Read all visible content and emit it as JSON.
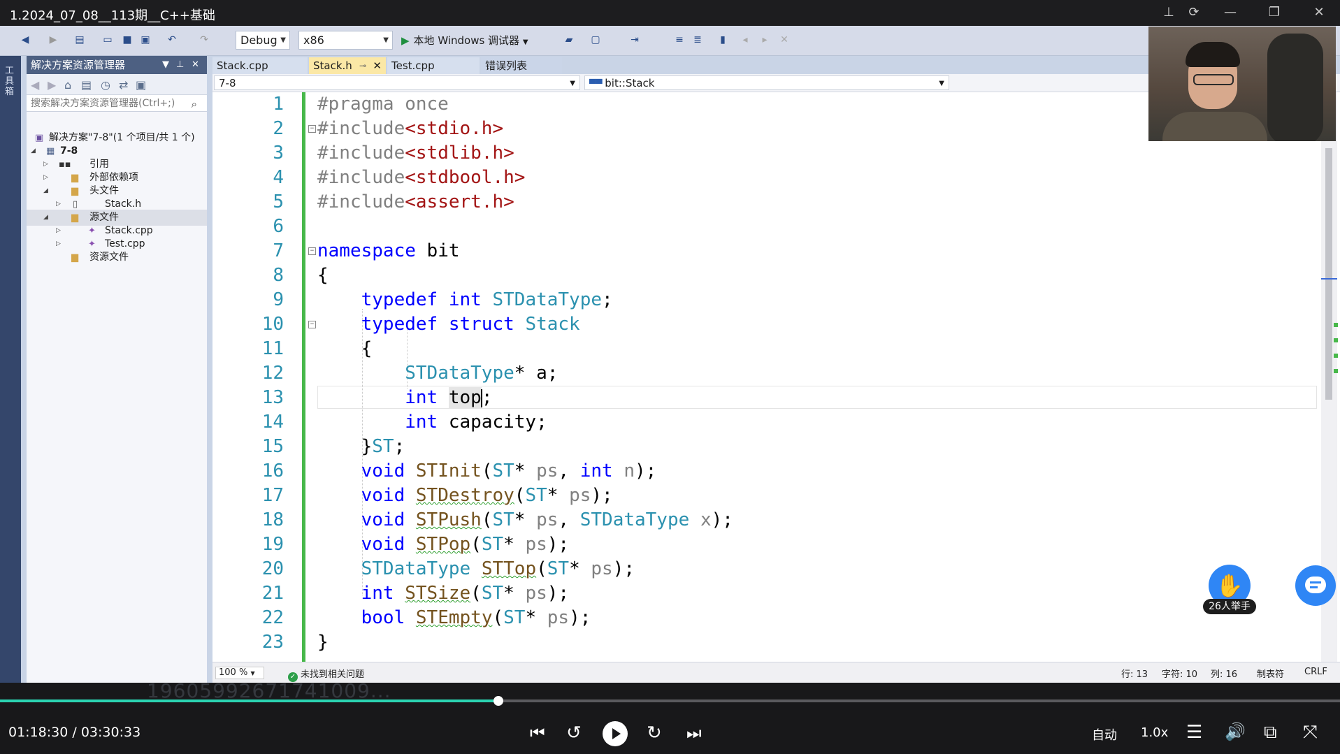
{
  "player": {
    "title": "1.2024_07_08__113期__C++基础",
    "time_current": "01:18:30",
    "time_sep": "/",
    "time_total": "03:30:33",
    "progress": 0.372,
    "quality": "自动",
    "speed": "1.0x",
    "raise_hand_label": "26人举手",
    "watermark": "19605992671741009..."
  },
  "toolbar": {
    "config": "Debug",
    "platform": "x86",
    "run_label": "本地 Windows 调试器"
  },
  "side_tab": "工具箱",
  "solution_explorer": {
    "title": "解决方案资源管理器",
    "search_placeholder": "搜索解决方案资源管理器(Ctrl+;)",
    "solution": "解决方案\"7-8\"(1 个项目/共 1 个)",
    "project": "7-8",
    "nodes": {
      "refs": "引用",
      "external": "外部依赖项",
      "headers": "头文件",
      "stack_h": "Stack.h",
      "sources": "源文件",
      "stack_cpp": "Stack.cpp",
      "test_cpp": "Test.cpp",
      "resources": "资源文件"
    }
  },
  "tabs": [
    "Stack.cpp",
    "Stack.h",
    "Test.cpp",
    "错误列表"
  ],
  "nav": {
    "project": "7-8",
    "scope": "bit::Stack"
  },
  "code": {
    "numbers": [
      "1",
      "2",
      "3",
      "4",
      "5",
      "6",
      "7",
      "8",
      "9",
      "10",
      "11",
      "12",
      "13",
      "14",
      "15",
      "16",
      "17",
      "18",
      "19",
      "20",
      "21",
      "22",
      "23"
    ],
    "pragma": "#pragma once",
    "include_kw": "#include",
    "includes": [
      "<stdio.h>",
      "<stdlib.h>",
      "<stdbool.h>",
      "<assert.h>"
    ],
    "namespace_kw": "namespace",
    "namespace_name": " bit",
    "lbrace": "{",
    "rbrace": "}",
    "typedef_kw": "typedef",
    "int_kw": "int",
    "struct_kw": "struct",
    "void_kw": "void",
    "bool_kw": "bool",
    "type_name": "STDataType",
    "struct_name": "Stack",
    "alias": "ST",
    "member_a": "a",
    "member_top": "top",
    "member_capacity": "capacity",
    "param_ps": "ps",
    "param_n": "n",
    "param_x": "x",
    "fn_init": "STInit",
    "fn_destroy": "STDestroy",
    "fn_push": "STPush",
    "fn_pop": "STPop",
    "fn_top": "STTop",
    "fn_size": "STSize",
    "fn_empty": "STEmpty"
  },
  "status": {
    "zoom": "100 %",
    "issues": "未找到相关问题",
    "row": "行: 13",
    "char": "字符: 10",
    "col": "列: 16",
    "tab": "制表符",
    "eol": "CRLF"
  }
}
